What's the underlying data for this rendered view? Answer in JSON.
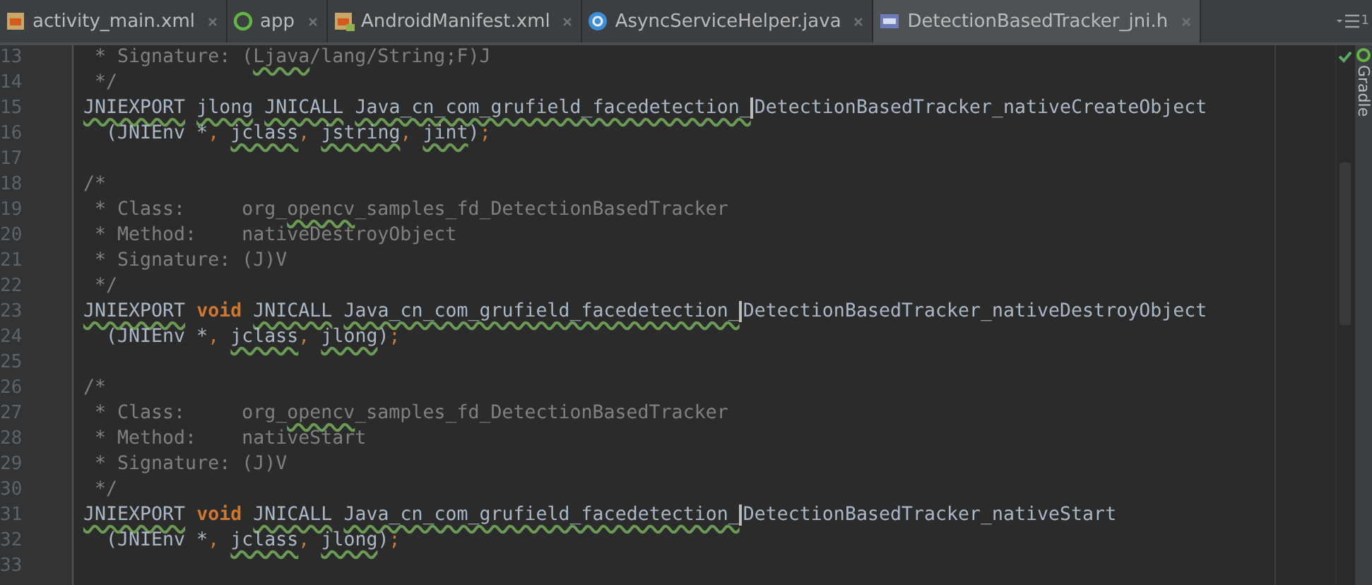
{
  "tabs": [
    {
      "label": "activity_main.xml",
      "kind": "xml",
      "selected": false
    },
    {
      "label": "app",
      "kind": "module",
      "selected": false
    },
    {
      "label": "AndroidManifest.xml",
      "kind": "manifest",
      "selected": false
    },
    {
      "label": "AsyncServiceHelper.java",
      "kind": "class",
      "selected": false
    },
    {
      "label": "DetectionBasedTracker_jni.h",
      "kind": "cpp",
      "selected": true
    }
  ],
  "overflow_count": "1",
  "tool_window": "Gradle",
  "lines": [
    {
      "number": "13",
      "tokens": [
        {
          "kind": "comment",
          "text": " * Signature: (",
          "typo": false
        },
        {
          "kind": "comment",
          "text": "Ljava",
          "typo": true
        },
        {
          "kind": "comment",
          "text": "/lang/String;F)J",
          "typo": false
        }
      ]
    },
    {
      "number": "14",
      "tokens": [
        {
          "kind": "comment",
          "text": " */",
          "typo": false
        }
      ]
    },
    {
      "number": "15",
      "tokens": [
        {
          "kind": "plain",
          "text": "JNIEXPORT",
          "typo": true
        },
        {
          "kind": "plain",
          "text": " jlong",
          "typo": true
        },
        {
          "kind": "plain",
          "text": " JNICALL",
          "typo": true
        },
        {
          "kind": "plain",
          "text": " Java_cn_com_grufield_facedetection_",
          "typo": true
        },
        {
          "kind": "caret"
        },
        {
          "kind": "plain",
          "text": "DetectionBasedTracker_nativeCreateObject",
          "typo": false
        }
      ]
    },
    {
      "number": "16",
      "tokens": [
        {
          "kind": "plain",
          "text": "  (JNIEnv *",
          "typo": false
        },
        {
          "kind": "punct",
          "text": ",",
          "typo": false
        },
        {
          "kind": "plain",
          "text": " jclass",
          "typo": true
        },
        {
          "kind": "punct",
          "text": ",",
          "typo": false
        },
        {
          "kind": "plain",
          "text": " jstring",
          "typo": true
        },
        {
          "kind": "punct",
          "text": ",",
          "typo": false
        },
        {
          "kind": "plain",
          "text": " jint",
          "typo": true
        },
        {
          "kind": "plain",
          "text": ")",
          "typo": false
        },
        {
          "kind": "punct",
          "text": ";",
          "typo": false
        }
      ]
    },
    {
      "number": "17"
    },
    {
      "number": "18",
      "tokens": [
        {
          "kind": "comment",
          "text": "/*",
          "typo": false
        }
      ]
    },
    {
      "number": "19",
      "tokens": [
        {
          "kind": "comment",
          "text": " * Class:     org_",
          "typo": false
        },
        {
          "kind": "comment",
          "text": "opencv",
          "typo": true
        },
        {
          "kind": "comment",
          "text": "_samples_fd_DetectionBasedTracker",
          "typo": false
        }
      ]
    },
    {
      "number": "20",
      "tokens": [
        {
          "kind": "comment",
          "text": " * Method:    nativeDestroyObject",
          "typo": false
        }
      ]
    },
    {
      "number": "21",
      "tokens": [
        {
          "kind": "comment",
          "text": " * Signature: (J)V",
          "typo": false
        }
      ]
    },
    {
      "number": "22",
      "tokens": [
        {
          "kind": "comment",
          "text": " */",
          "typo": false
        }
      ]
    },
    {
      "number": "23",
      "tokens": [
        {
          "kind": "plain",
          "text": "JNIEXPORT",
          "typo": true
        },
        {
          "kind": "keyword",
          "text": " void",
          "typo": false
        },
        {
          "kind": "plain",
          "text": " JNICALL",
          "typo": true
        },
        {
          "kind": "plain",
          "text": " Java_cn_com_grufield_facedetection_",
          "typo": true
        },
        {
          "kind": "caret"
        },
        {
          "kind": "plain",
          "text": "DetectionBasedTracker_nativeDestroyObject",
          "typo": false
        }
      ]
    },
    {
      "number": "24",
      "tokens": [
        {
          "kind": "plain",
          "text": "  (JNIEnv *",
          "typo": false
        },
        {
          "kind": "punct",
          "text": ",",
          "typo": false
        },
        {
          "kind": "plain",
          "text": " jclass",
          "typo": true
        },
        {
          "kind": "punct",
          "text": ",",
          "typo": false
        },
        {
          "kind": "plain",
          "text": " jlong",
          "typo": true
        },
        {
          "kind": "plain",
          "text": ")",
          "typo": false
        },
        {
          "kind": "punct",
          "text": ";",
          "typo": false
        }
      ]
    },
    {
      "number": "25"
    },
    {
      "number": "26",
      "tokens": [
        {
          "kind": "comment",
          "text": "/*",
          "typo": false
        }
      ]
    },
    {
      "number": "27",
      "tokens": [
        {
          "kind": "comment",
          "text": " * Class:     org_",
          "typo": false
        },
        {
          "kind": "comment",
          "text": "opencv",
          "typo": true
        },
        {
          "kind": "comment",
          "text": "_samples_fd_DetectionBasedTracker",
          "typo": false
        }
      ]
    },
    {
      "number": "28",
      "tokens": [
        {
          "kind": "comment",
          "text": " * Method:    nativeStart",
          "typo": false
        }
      ]
    },
    {
      "number": "29",
      "tokens": [
        {
          "kind": "comment",
          "text": " * Signature: (J)V",
          "typo": false
        }
      ]
    },
    {
      "number": "30",
      "tokens": [
        {
          "kind": "comment",
          "text": " */",
          "typo": false
        }
      ]
    },
    {
      "number": "31",
      "tokens": [
        {
          "kind": "plain",
          "text": "JNIEXPORT",
          "typo": true
        },
        {
          "kind": "keyword",
          "text": " void",
          "typo": false
        },
        {
          "kind": "plain",
          "text": " JNICALL",
          "typo": true
        },
        {
          "kind": "plain",
          "text": " Java_cn_com_grufield_facedetection_",
          "typo": true
        },
        {
          "kind": "caret"
        },
        {
          "kind": "plain",
          "text": "DetectionBasedTracker_nativeStart",
          "typo": false
        }
      ]
    },
    {
      "number": "32",
      "tokens": [
        {
          "kind": "plain",
          "text": "  (JNIEnv *",
          "typo": false
        },
        {
          "kind": "punct",
          "text": ",",
          "typo": false
        },
        {
          "kind": "plain",
          "text": " jclass",
          "typo": true
        },
        {
          "kind": "punct",
          "text": ",",
          "typo": false
        },
        {
          "kind": "plain",
          "text": " jlong",
          "typo": true
        },
        {
          "kind": "plain",
          "text": ")",
          "typo": false
        },
        {
          "kind": "punct",
          "text": ";",
          "typo": false
        }
      ]
    },
    {
      "number": "33"
    }
  ]
}
